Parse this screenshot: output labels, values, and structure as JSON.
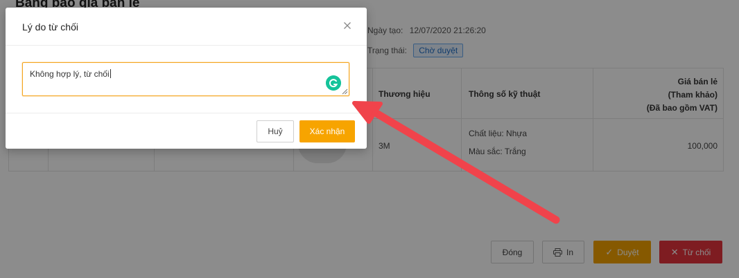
{
  "page": {
    "title": "Bảng báo giá bán lẻ",
    "created_label": "Ngày tạo:",
    "created_value": "12/07/2020 21:26:20",
    "status_label": "Trạng thái:",
    "status_value": "Chờ duyệt"
  },
  "table": {
    "headers": {
      "brand": "Thương hiệu",
      "specs": "Thông số kỹ thuật",
      "price_line1": "Giá bán lẻ",
      "price_line2": "(Tham khảo)",
      "price_line3": "(Đã bao gồm VAT)"
    },
    "row": {
      "brand": "3M",
      "spec1_key": "Chất liệu:",
      "spec1_val": "Nhựa",
      "spec2_key": "Màu sắc:",
      "spec2_val": "Trắng",
      "price": "100,000"
    }
  },
  "actions": {
    "close_label": "Đóng",
    "print_label": "In",
    "approve_label": "Duyệt",
    "reject_label": "Từ chối"
  },
  "modal": {
    "title": "Lý do từ chối",
    "reason_value": "Không hợp lý, từ chối",
    "cancel_label": "Huỷ",
    "confirm_label": "Xác nhận"
  },
  "icons": {
    "close": "close-icon",
    "grammarly": "grammarly-icon",
    "print": "printer-icon",
    "approve": "check-icon",
    "reject": "x-icon"
  },
  "colors": {
    "accent": "#f7a400",
    "reject": "#e6343c",
    "status_badge": "#1f6ec6",
    "arrow": "#f0434b"
  }
}
